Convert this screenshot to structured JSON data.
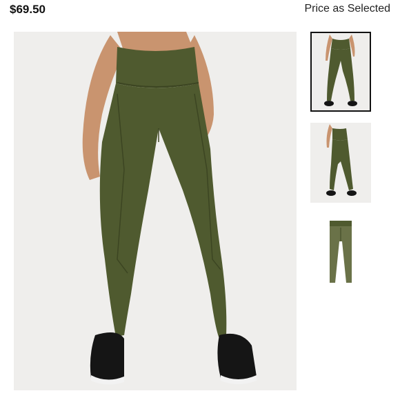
{
  "product": {
    "price": "$69.50",
    "price_note": "Price as Selected"
  },
  "gallery": {
    "main_image": "olive-green-leggings-model-front",
    "thumbnails": [
      {
        "name": "model-front-thumbnail",
        "selected": true
      },
      {
        "name": "model-side-thumbnail",
        "selected": false
      },
      {
        "name": "flat-lay-thumbnail",
        "selected": false
      }
    ]
  },
  "colors": {
    "legging": "#4f5a2f",
    "legging_shadow": "#3c4522",
    "skin": "#c9946f",
    "shoe": "#151515",
    "sole": "#f2f2f2",
    "photo_bg": "#efeeec",
    "selected_border": "#111111"
  }
}
